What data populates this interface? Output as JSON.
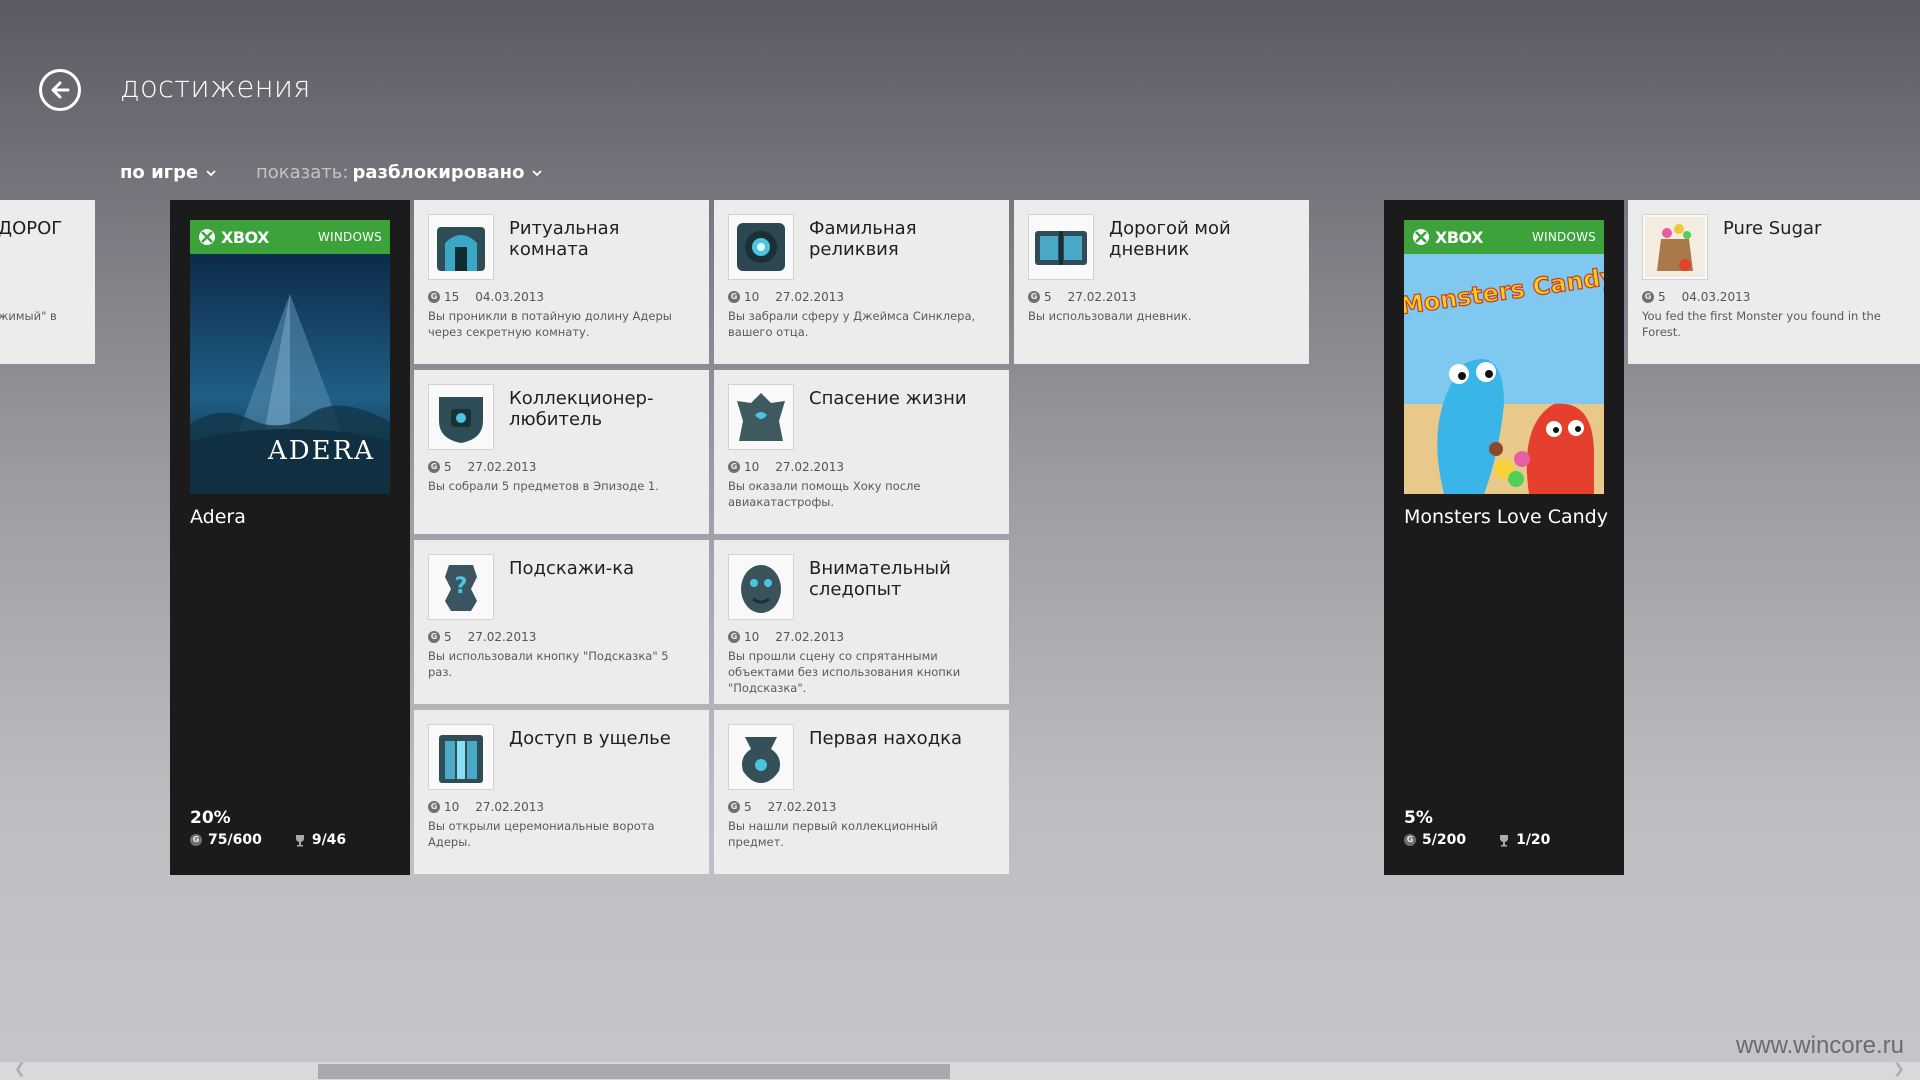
{
  "page": {
    "title": "достижения"
  },
  "filters": {
    "by_game": "по игре",
    "show_label": "показать:",
    "show_value": "разблокировано"
  },
  "partial_tile": {
    "name": "ДОРОГ",
    "desc": "жимый\" в"
  },
  "games": [
    {
      "brand": "XBOX",
      "platform": "WINDOWS",
      "cover_title": "ADERA",
      "title": "Adera",
      "percent": "20%",
      "gamerscore": "75/600",
      "achievements": "9/46"
    },
    {
      "brand": "XBOX",
      "platform": "WINDOWS",
      "cover_title": "Monsters Candy",
      "title": "Monsters Love Candy",
      "percent": "5%",
      "gamerscore": "5/200",
      "achievements": "1/20"
    }
  ],
  "achievements": [
    {
      "name": "Ритуальная комната",
      "points": "15",
      "date": "04.03.2013",
      "desc": "Вы проникли в потайную долину Адеры через секретную комнату."
    },
    {
      "name": "Фамильная реликвия",
      "points": "10",
      "date": "27.02.2013",
      "desc": "Вы забрали сферу у Джеймса Синклера, вашего отца."
    },
    {
      "name": "Дорогой мой дневник",
      "points": "5",
      "date": "27.02.2013",
      "desc": "Вы использовали дневник."
    },
    {
      "name": "Коллекционер-любитель",
      "points": "5",
      "date": "27.02.2013",
      "desc": "Вы собрали 5 предметов в Эпизоде 1."
    },
    {
      "name": "Спасение жизни",
      "points": "10",
      "date": "27.02.2013",
      "desc": "Вы оказали помощь Хоку после авиакатастрофы."
    },
    {
      "name": "Подскажи-ка",
      "points": "5",
      "date": "27.02.2013",
      "desc": "Вы использовали кнопку \"Подсказка\" 5 раз."
    },
    {
      "name": "Внимательный следопыт",
      "points": "10",
      "date": "27.02.2013",
      "desc": "Вы прошли сцену со спрятанными объектами без использования кнопки \"Подсказка\"."
    },
    {
      "name": "Доступ в ущелье",
      "points": "10",
      "date": "27.02.2013",
      "desc": "Вы открыли церемониальные ворота Адеры."
    },
    {
      "name": "Первая находка",
      "points": "5",
      "date": "27.02.2013",
      "desc": "Вы нашли первый коллекционный предмет."
    },
    {
      "name": "Pure Sugar",
      "points": "5",
      "date": "04.03.2013",
      "desc": "You fed the first Monster you found in the Forest."
    }
  ],
  "coin_glyph": "G",
  "watermark": "www.wincore.ru",
  "colors": {
    "xbox_green": "#3ca33a",
    "tile_bg": "#ececec",
    "game_tile_bg": "#1b1b1b"
  }
}
